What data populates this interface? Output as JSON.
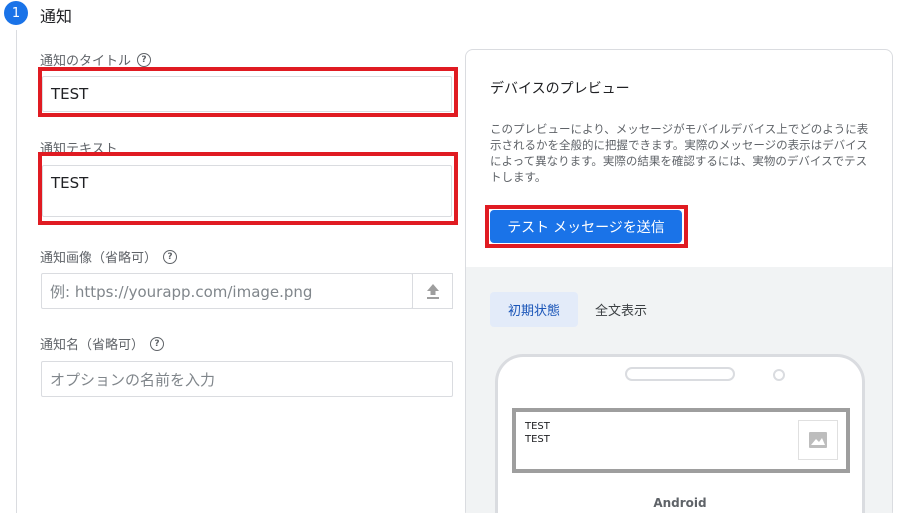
{
  "step": {
    "number": "1",
    "title": "通知"
  },
  "form": {
    "title_label": "通知のタイトル",
    "title_value": "TEST",
    "text_label": "通知テキスト",
    "text_value": "TEST",
    "image_label": "通知画像（省略可）",
    "image_placeholder": "例: https://yourapp.com/image.png",
    "name_label": "通知名（省略可）",
    "name_placeholder": "オプションの名前を入力",
    "help_glyph": "?"
  },
  "preview": {
    "title": "デバイスのプレビュー",
    "description": "このプレビューにより、メッセージがモバイルデバイス上でどのように表示されるかを全般的に把握できます。実際のメッセージの表示はデバイスによって異なります。実際の結果を確認するには、実物のデバイスでテストします。",
    "test_button": "テスト メッセージを送信",
    "tabs": [
      "初期状態",
      "全文表示"
    ],
    "notification_title": "TEST",
    "notification_text": "TEST",
    "device_label": "Android"
  },
  "colors": {
    "accent": "#1a73e8",
    "highlight": "#e01b22"
  },
  "icons": {
    "upload": "upload-icon",
    "help": "help-circle-icon",
    "image": "image-icon"
  }
}
